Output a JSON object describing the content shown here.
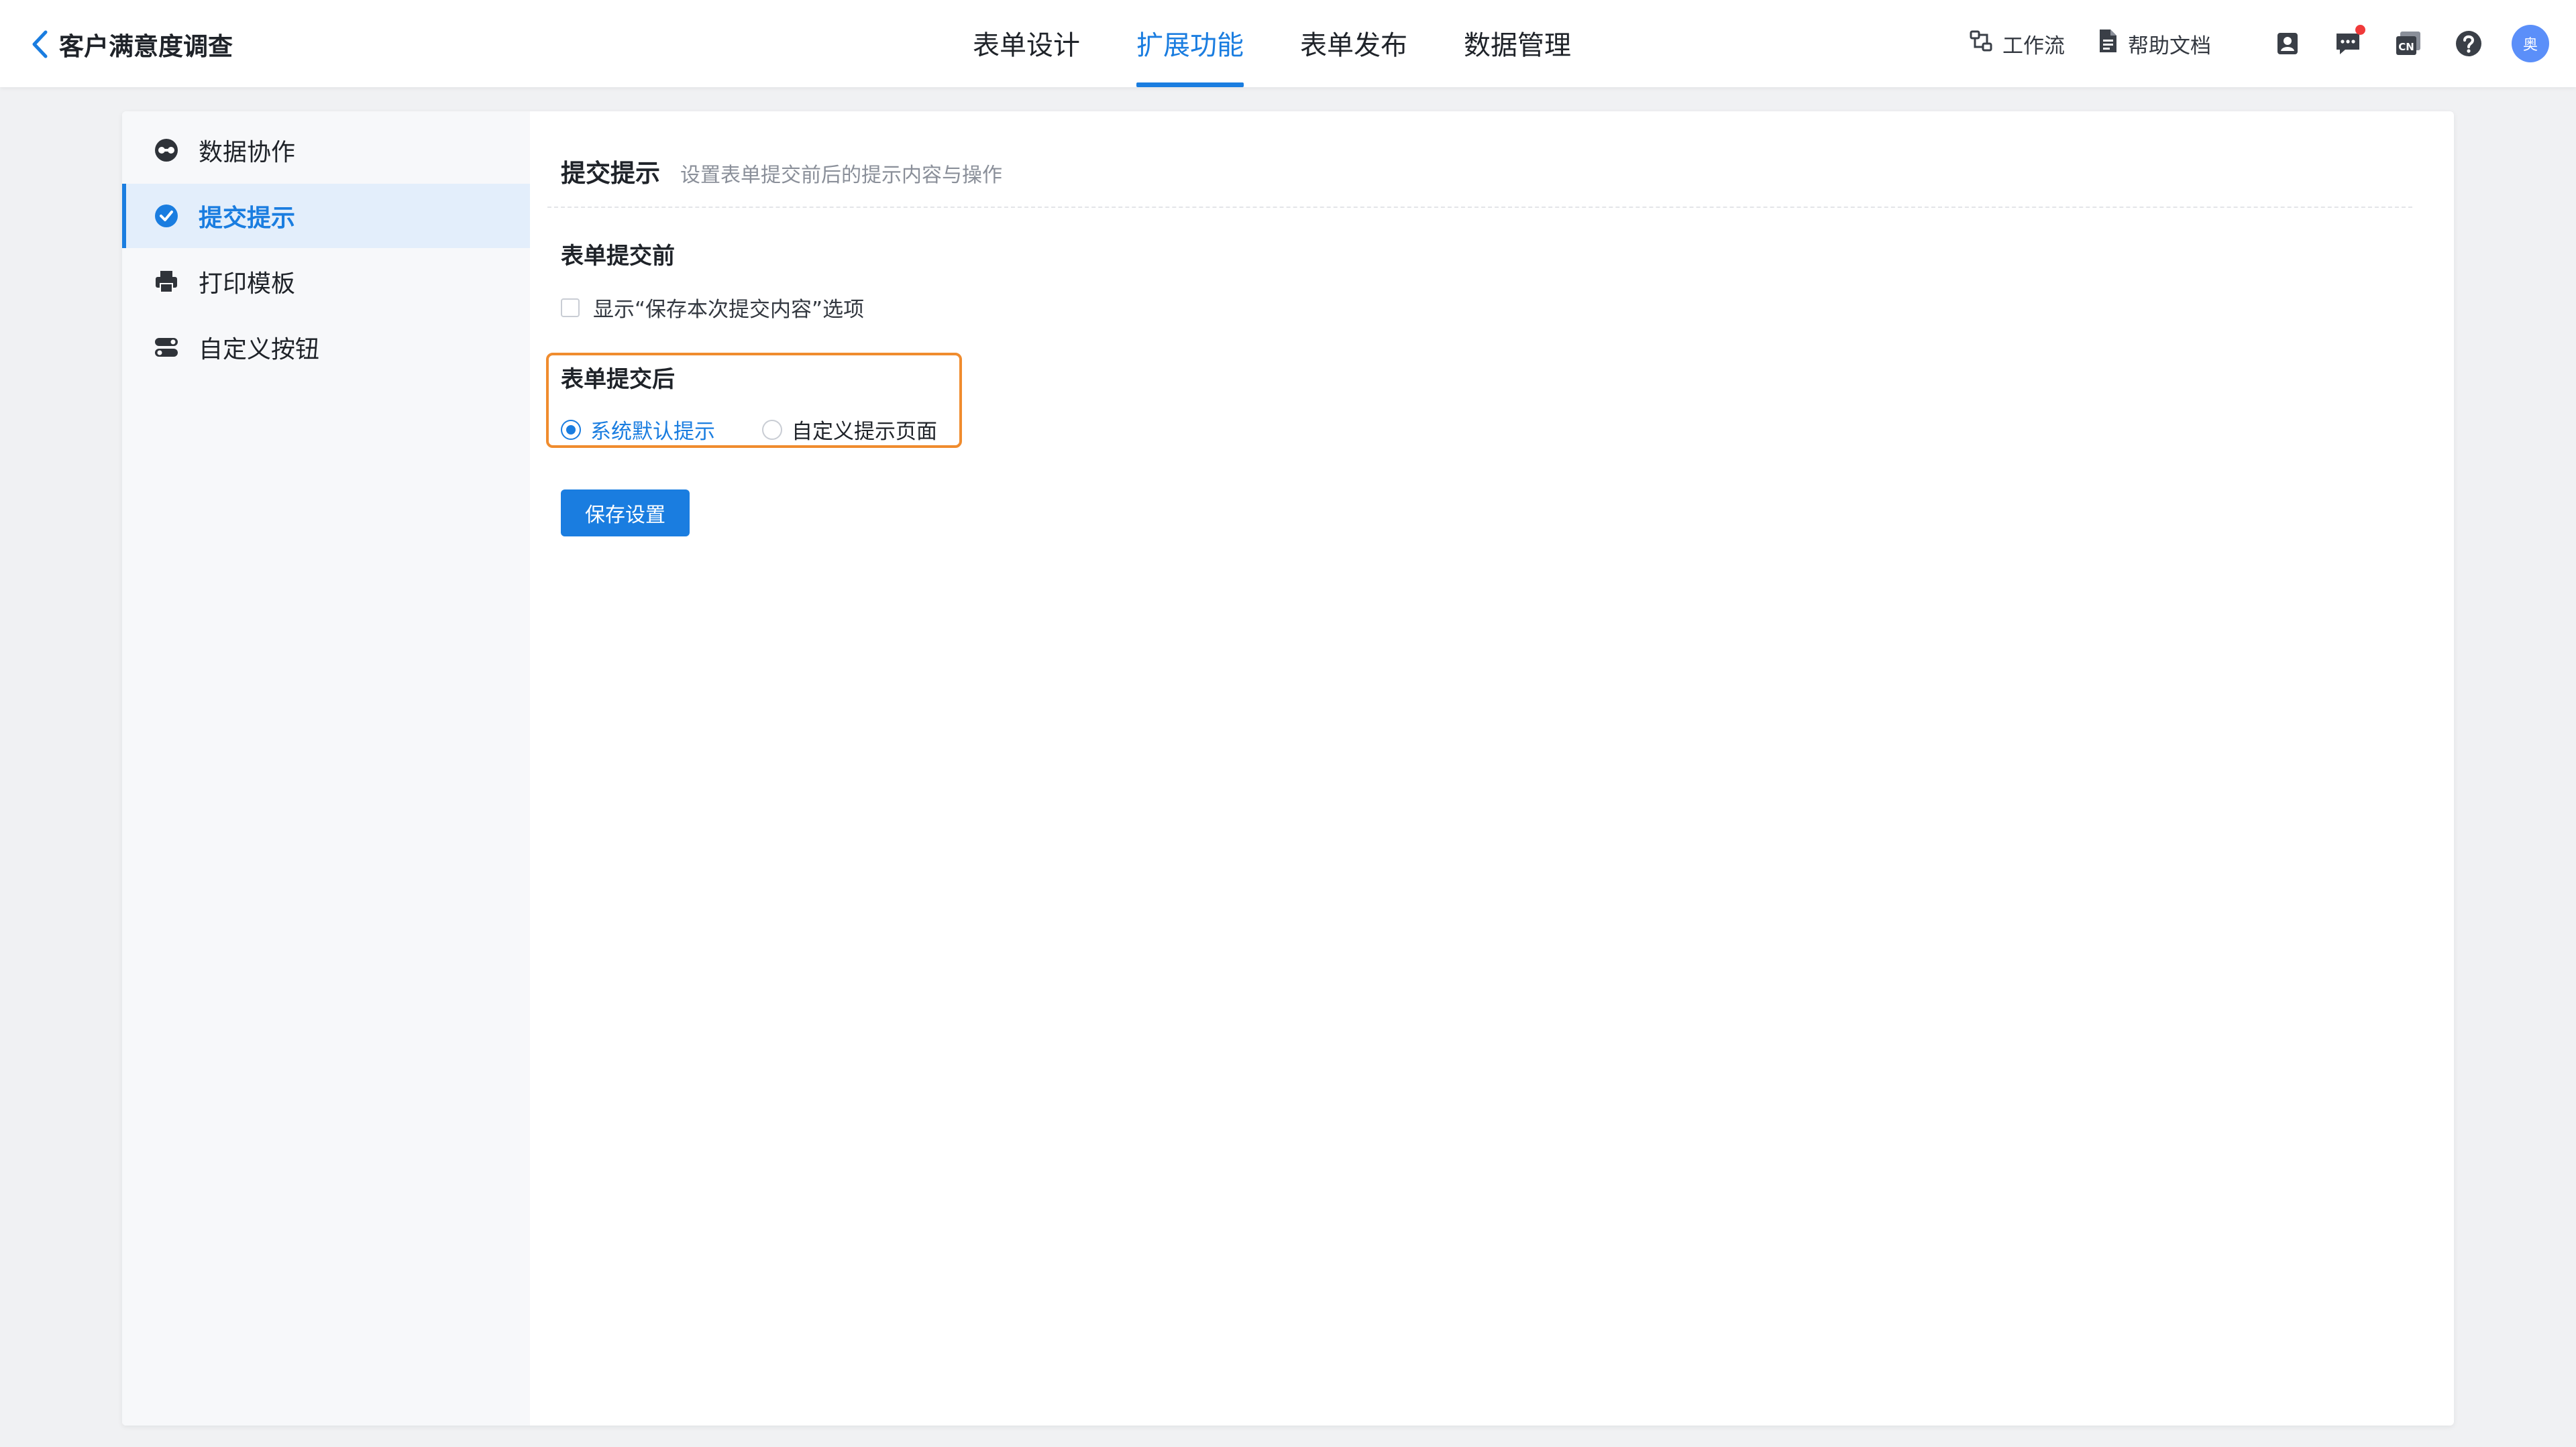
{
  "app": {
    "title": "客户满意度调查"
  },
  "tabs": [
    {
      "label": "表单设计"
    },
    {
      "label": "扩展功能"
    },
    {
      "label": "表单发布"
    },
    {
      "label": "数据管理"
    }
  ],
  "header_right": {
    "workflow": "工作流",
    "help_docs": "帮助文档",
    "language": "CN",
    "avatar_text": "奥"
  },
  "sidebar": {
    "items": [
      {
        "label": "数据协作",
        "icon": "data-collaboration-icon"
      },
      {
        "label": "提交提示",
        "icon": "check-circle-icon"
      },
      {
        "label": "打印模板",
        "icon": "printer-icon"
      },
      {
        "label": "自定义按钮",
        "icon": "toggle-icon"
      }
    ]
  },
  "main": {
    "section_title": "提交提示",
    "section_desc": "设置表单提交前后的提示内容与操作",
    "before_heading": "表单提交前",
    "before_option": "显示“保存本次提交内容”选项",
    "after_heading": "表单提交后",
    "after_options": [
      {
        "label": "系统默认提示",
        "selected": true
      },
      {
        "label": "自定义提示页面",
        "selected": false
      }
    ],
    "save_label": "保存设置"
  },
  "colors": {
    "accent": "#1a7de0",
    "highlight_border": "#f08c2e",
    "notification_dot": "#f03a3a",
    "avatar": "#5b8ff9"
  }
}
